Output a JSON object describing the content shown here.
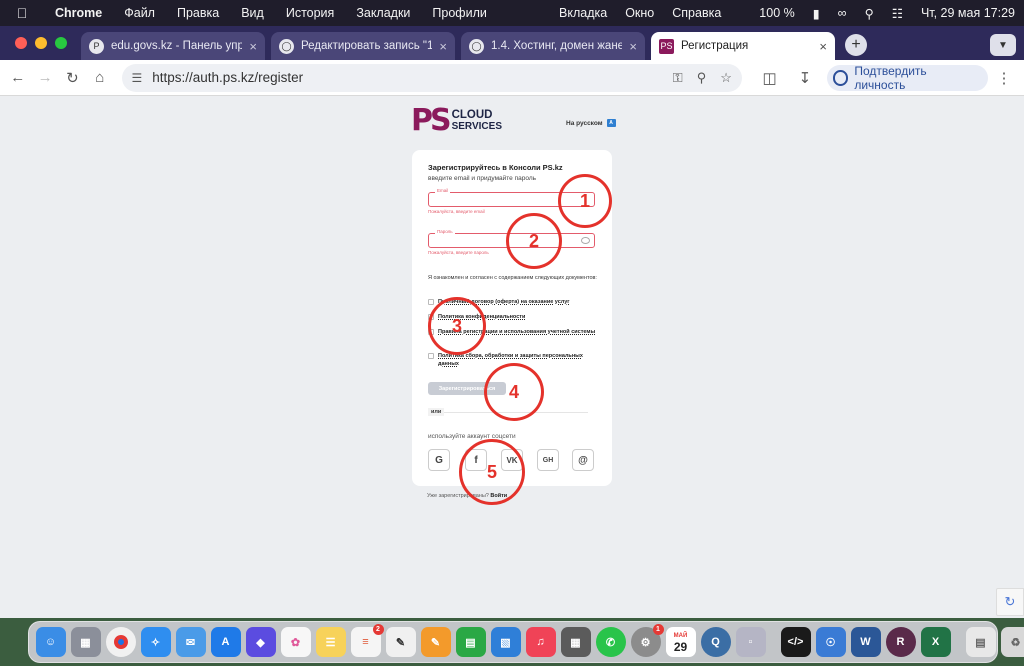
{
  "menubar": {
    "app": "Chrome",
    "items": [
      "Файл",
      "Правка",
      "Вид",
      "История",
      "Закладки",
      "Профили",
      "Вкладка",
      "Окно",
      "Справка"
    ],
    "battery": "100 %",
    "datetime": "Чт, 29 мая  17:29"
  },
  "tabs": [
    {
      "title": "edu.govs.kz - Панель управл",
      "favicon": "P"
    },
    {
      "title": "Редактировать запись \"1.4.",
      "favicon": "globe"
    },
    {
      "title": "1.4. Хостинг, домен жане ос",
      "favicon": "globe"
    },
    {
      "title": "Регистрация",
      "favicon": "PS"
    }
  ],
  "toolbar": {
    "url": "https://auth.ps.kz/register",
    "verify_label": "Подтвердить личность"
  },
  "page": {
    "logo_ps": "PS",
    "logo_cloud": "CLOUD",
    "logo_services": "SERVICES",
    "lang_label": "На русском",
    "title": "Зарегистрируйтесь в Консоли PS.kz",
    "subtitle": "введите email и придумайте пароль",
    "email_label": "Email",
    "email_error": "Пожалуйста, введите email",
    "password_label": "Пароль",
    "password_error": "Пожалуйста, введите пароль",
    "agree_text": "Я ознакомлен и согласен с содержанием следующих документов:",
    "documents": [
      "Публичный договор (оферта) на оказание услуг",
      "Политика конфиденциальности",
      "Правила регистрации и использования учетной системы",
      "Политика сбора, обработки и защиты персональных данных"
    ],
    "register_button": "Зарегистрироваться",
    "or_label": "или",
    "social_label": "используйте аккаунт соцсети",
    "social": [
      "G",
      "f",
      "VK",
      "GH",
      "@"
    ],
    "login_prompt": "Уже зарегистрированы?",
    "login_link": "Войти"
  },
  "annotations": [
    "1",
    "2",
    "3",
    "4",
    "5"
  ],
  "dock": {
    "calendar_month": "МАЙ",
    "calendar_day": "29",
    "reminders_badge": "2",
    "settings_badge": "1"
  },
  "colors": {
    "brand": "#8b1a5c",
    "error": "#e35b6b",
    "annotation": "#e4322b",
    "tabstrip": "#2e2a5a"
  }
}
